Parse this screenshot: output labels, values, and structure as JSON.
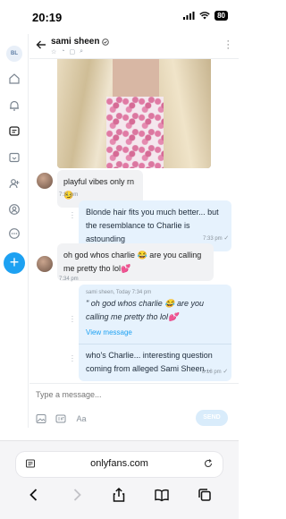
{
  "status_bar": {
    "time": "20:19",
    "battery": "80"
  },
  "rail": {
    "avatar_initials": "BL"
  },
  "header": {
    "name": "sami sheen"
  },
  "messages": [
    {
      "text": "playful vibes only rn 😏",
      "time": "7:11 pm"
    },
    {
      "text": "Blonde hair fits you much better... but the resemblance to Charlie is astounding",
      "time": "7:33 pm"
    },
    {
      "text": "oh god whos charlie 😂 are you calling me pretty tho lol💕",
      "time": "7:34 pm"
    },
    {
      "reply_header": "sami sheen, Today 7:34 pm",
      "reply_quote": "\" oh god whos charlie 😂 are you calling me pretty tho lol💕",
      "view_link": "View message",
      "text": "who's Charlie... interesting question coming from alleged Sami Sheen...",
      "time": "8:18 pm"
    }
  ],
  "composer": {
    "placeholder": "Type a message...",
    "format_label": "Aa",
    "send_label": "SEND"
  },
  "browser": {
    "url": "onlyfans.com"
  },
  "colors": {
    "accent": "#1da1f2",
    "bubble_out": "#e6f2fd",
    "bubble_in": "#f1f2f4"
  }
}
